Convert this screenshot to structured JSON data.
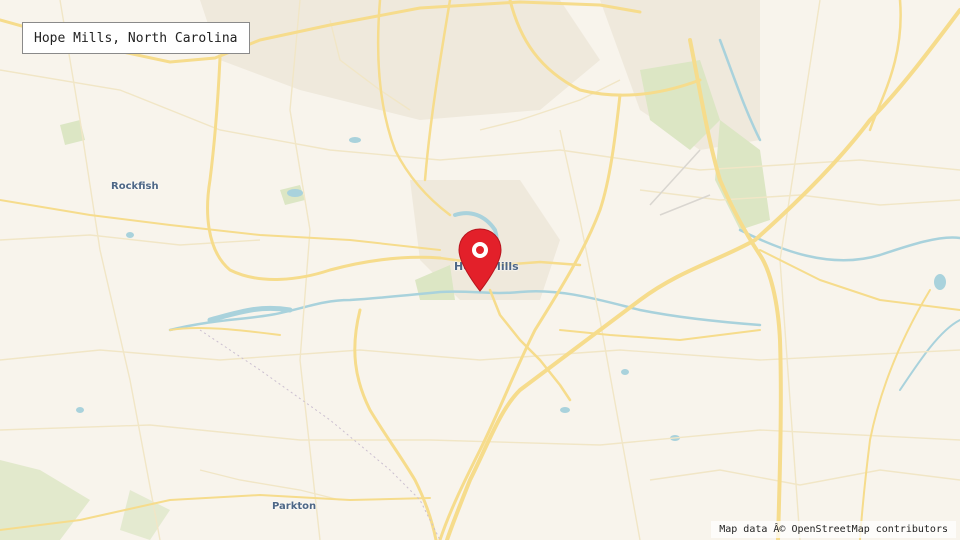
{
  "map": {
    "title": "Hope Mills, North Carolina",
    "places": {
      "rockfish": "Rockfish",
      "parkton": "Parkton",
      "hope_mills": "Hope Mills"
    },
    "attribution": "Map data Â© OpenStreetMap contributors",
    "marker_icon": "map-pin-icon",
    "colors": {
      "background": "#f8f4ec",
      "major_road": "#f6dc8c",
      "minor_road": "#f1e6c6",
      "water": "#a9d2dc",
      "park": "#dce6c4",
      "label": "#4e6786",
      "marker": "#e3202a"
    }
  }
}
